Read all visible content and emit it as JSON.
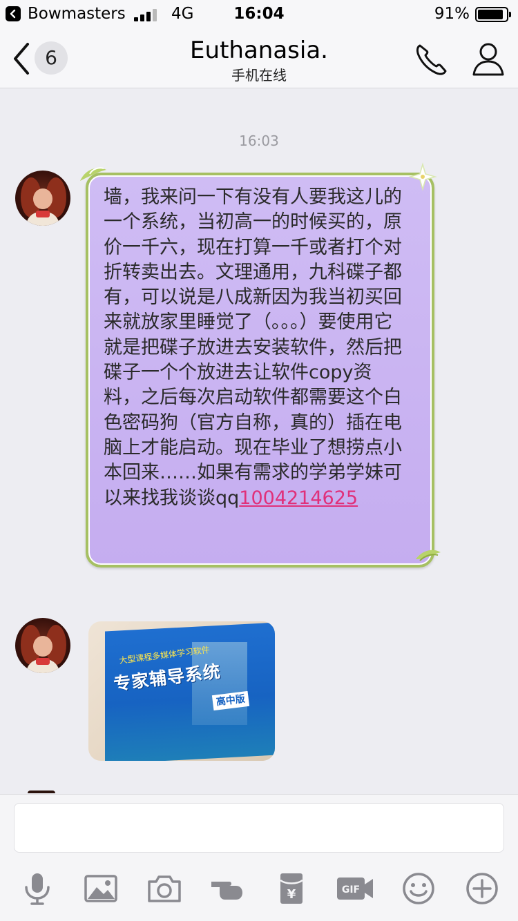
{
  "status_bar": {
    "app_name": "Bowmasters",
    "network": "4G",
    "time": "16:04",
    "battery_percent": "91%",
    "battery_level": 0.91,
    "signal_bars": 3
  },
  "nav": {
    "unread_count": "6",
    "title": "Euthanasia.",
    "subtitle": "手机在线"
  },
  "chat": {
    "timestamp": "16:03",
    "message_text": "墙，我来问一下有没有人要我这儿的一个系统，当初高一的时候买的，原价一千六，现在打算一千或者打个对折转卖出去。文理通用，九科碟子都有，可以说是八成新因为我当初买回来就放家里睡觉了（。。。）要使用它就是把碟子放进去安装软件，然后把碟子一个个放进去让软件copy资料，之后每次启动软件都需要这个白色密码狗（官方自称，真的）插在电脑上才能启动。现在毕业了想捞点小本回来……如果有需求的学弟学妹可以来找我谈谈qq",
    "qq_number": "1004214625",
    "photo": {
      "box_title": "专家辅导系统",
      "box_edition": "高中版",
      "box_small_title": "大型课程多媒体学习软件"
    }
  },
  "input": {
    "value": "",
    "placeholder": ""
  },
  "toolbar": {
    "items": [
      "microphone-icon",
      "image-icon",
      "camera-icon",
      "poke-icon",
      "red-packet-icon",
      "gif-icon",
      "emoji-icon",
      "plus-icon"
    ]
  },
  "colors": {
    "background": "#ededf2",
    "bubble": "#c9b3f2",
    "bubble_border": "#a6c063",
    "link": "#e0307a"
  }
}
